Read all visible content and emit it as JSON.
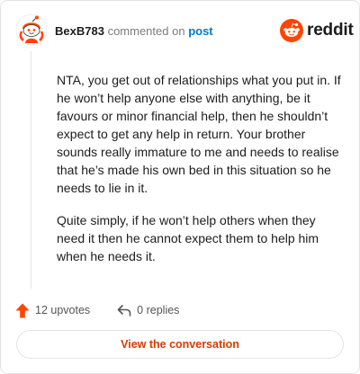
{
  "comment": {
    "username": "BexB783",
    "meta_text": "commented on",
    "post_link": "post",
    "paragraphs": [
      "NTA, you get out of relationships what you put in. If he won’t help anyone else with anything, be it favours or minor financial help, then he shouldn’t expect to get any help in return. Your brother sounds really immature to me and needs to realise that he’s made his own bed in this situation so he needs to lie in it.",
      "Quite simply, if he won’t help others when they need it then he cannot expect them to help him when he needs it."
    ]
  },
  "brand": {
    "name": "reddit",
    "color": "#ff4500"
  },
  "footer": {
    "upvotes": "12 upvotes",
    "replies": "0 replies"
  },
  "cta": {
    "label": "View the conversation"
  },
  "icons": {
    "avatar": "snoo-avatar-icon",
    "logo": "reddit-logo-icon",
    "upvote": "upvote-arrow-icon",
    "reply": "reply-arrow-icon"
  }
}
